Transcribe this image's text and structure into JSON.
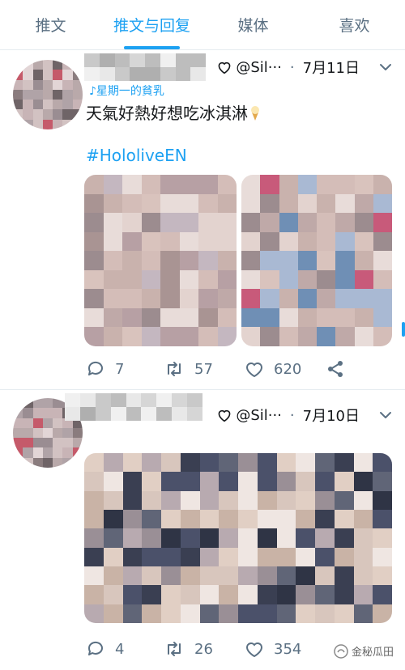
{
  "tabs": [
    {
      "label": "推文",
      "active": false
    },
    {
      "label": "推文与回复",
      "active": true
    },
    {
      "label": "媒体",
      "active": false
    },
    {
      "label": "喜欢",
      "active": false
    }
  ],
  "tweets": [
    {
      "handle": "@Sil···",
      "dot": "·",
      "date": "7月11日",
      "partial_name": "♪星期一的貧乳",
      "text": "天氣好熱好想吃冰淇淋",
      "hashtag": "#HololiveEN",
      "replies": "7",
      "retweets": "57",
      "likes": "620"
    },
    {
      "handle": "@Sil···",
      "dot": "·",
      "date": "7月10日",
      "replies": "4",
      "retweets": "26",
      "likes": "354"
    }
  ],
  "watermark": "金秘瓜田",
  "colors": {
    "accent": "#1da1f2",
    "muted": "#5b7083",
    "text": "#14171a"
  }
}
